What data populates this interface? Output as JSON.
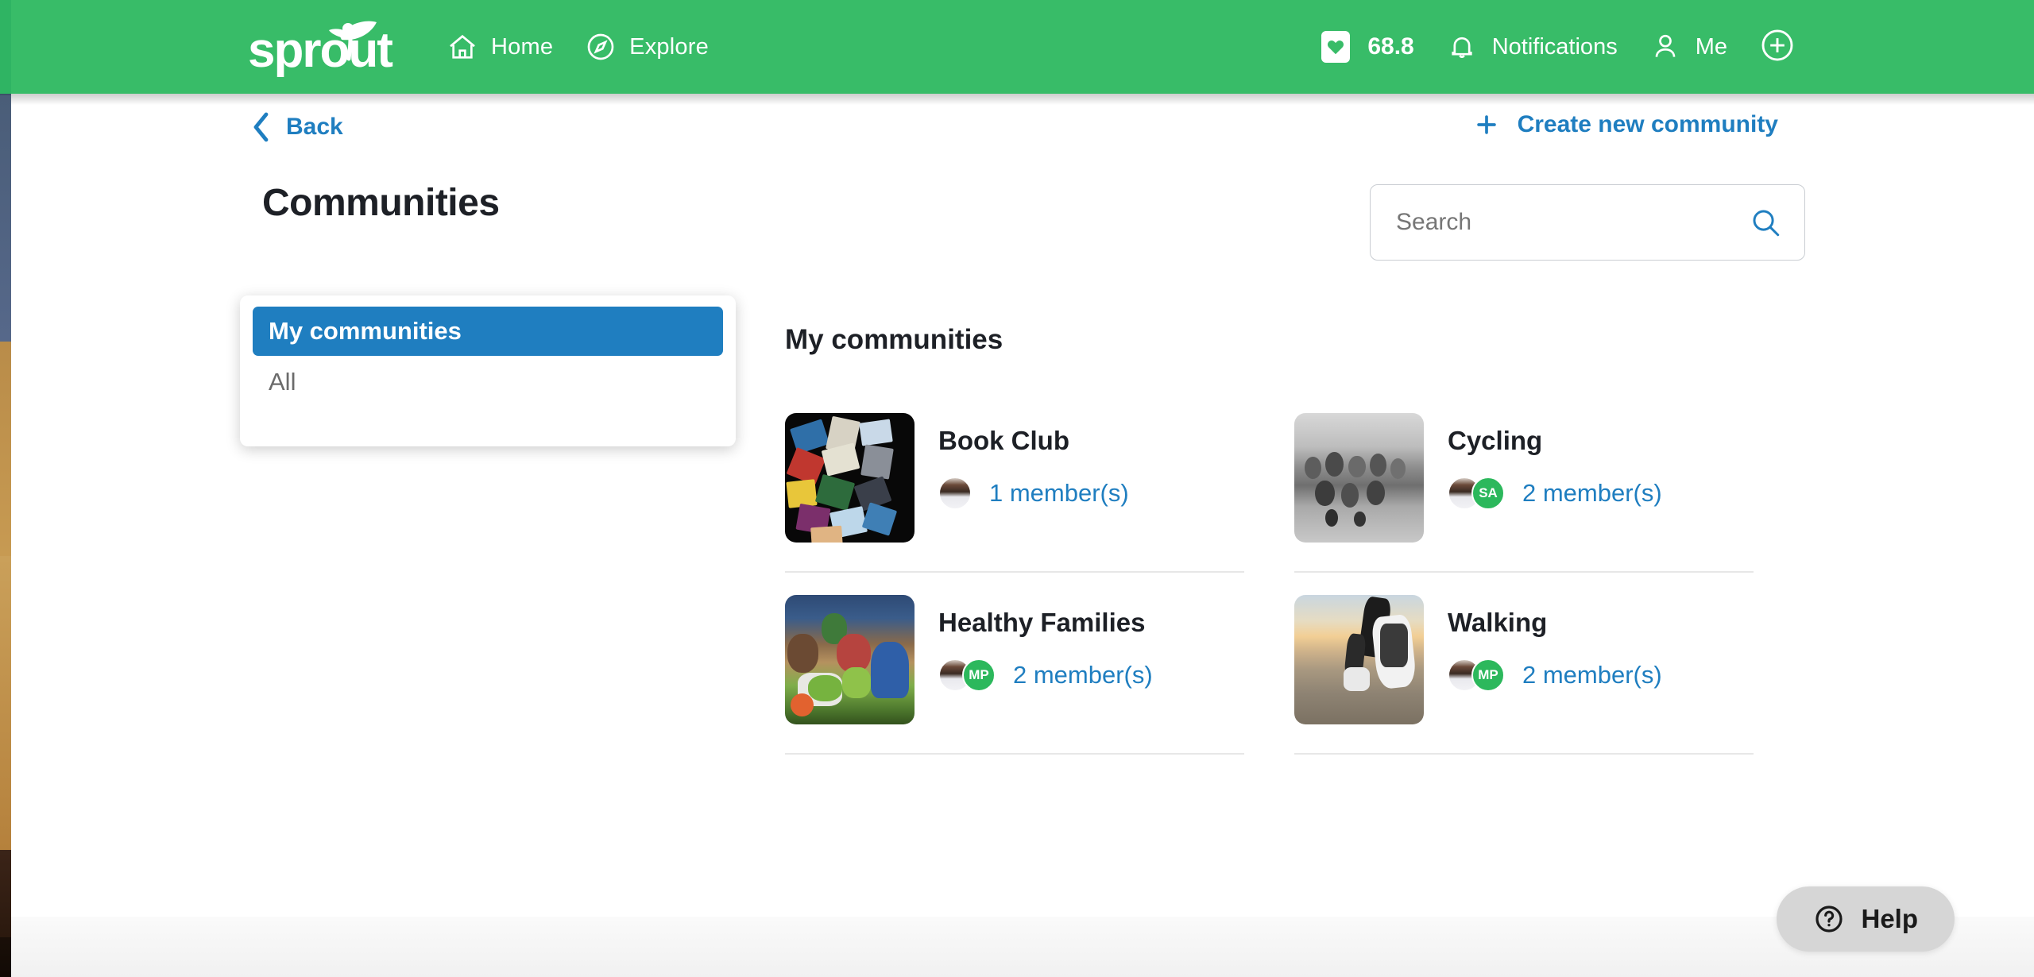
{
  "header": {
    "brand": "sprout",
    "nav": [
      {
        "label": "Home",
        "icon": "home-icon"
      },
      {
        "label": "Explore",
        "icon": "compass-icon"
      }
    ],
    "points": "68.8",
    "points_icon": "heart-badge-icon",
    "notifications_label": "Notifications",
    "notifications_icon": "bell-icon",
    "me_label": "Me",
    "me_icon": "person-icon",
    "add_icon": "plus-circle-icon",
    "bar_color": "#38bc68"
  },
  "toolbar": {
    "back_label": "Back",
    "back_icon": "chevron-left-icon",
    "create_label": "Create new community",
    "create_icon": "plus-icon",
    "link_color": "#1f7ec0"
  },
  "page_title": "Communities",
  "search": {
    "placeholder": "Search",
    "value": "",
    "icon": "search-icon"
  },
  "filter_dropdown": {
    "options": [
      {
        "label": "My communities",
        "selected": true
      },
      {
        "label": "All",
        "selected": false
      }
    ],
    "selected_color": "#1f7ec0"
  },
  "main": {
    "section_title": "My communities",
    "communities": [
      {
        "name": "Book Club",
        "member_count_label": "1 member(s)",
        "thumbnail": "books-photo",
        "avatars": [
          {
            "type": "photo",
            "initials": ""
          }
        ]
      },
      {
        "name": "Cycling",
        "member_count_label": "2 member(s)",
        "thumbnail": "cyclists-photo",
        "avatars": [
          {
            "type": "photo",
            "initials": ""
          },
          {
            "type": "initials",
            "initials": "SA"
          }
        ]
      },
      {
        "name": "Healthy Families",
        "member_count_label": "2 member(s)",
        "thumbnail": "family-salad-photo",
        "avatars": [
          {
            "type": "photo",
            "initials": ""
          },
          {
            "type": "initials",
            "initials": "MP"
          }
        ]
      },
      {
        "name": "Walking",
        "member_count_label": "2 member(s)",
        "thumbnail": "walking-shoes-photo",
        "avatars": [
          {
            "type": "photo",
            "initials": ""
          },
          {
            "type": "initials",
            "initials": "MP"
          }
        ]
      }
    ]
  },
  "help_widget": {
    "label": "Help",
    "icon": "question-circle-icon"
  }
}
